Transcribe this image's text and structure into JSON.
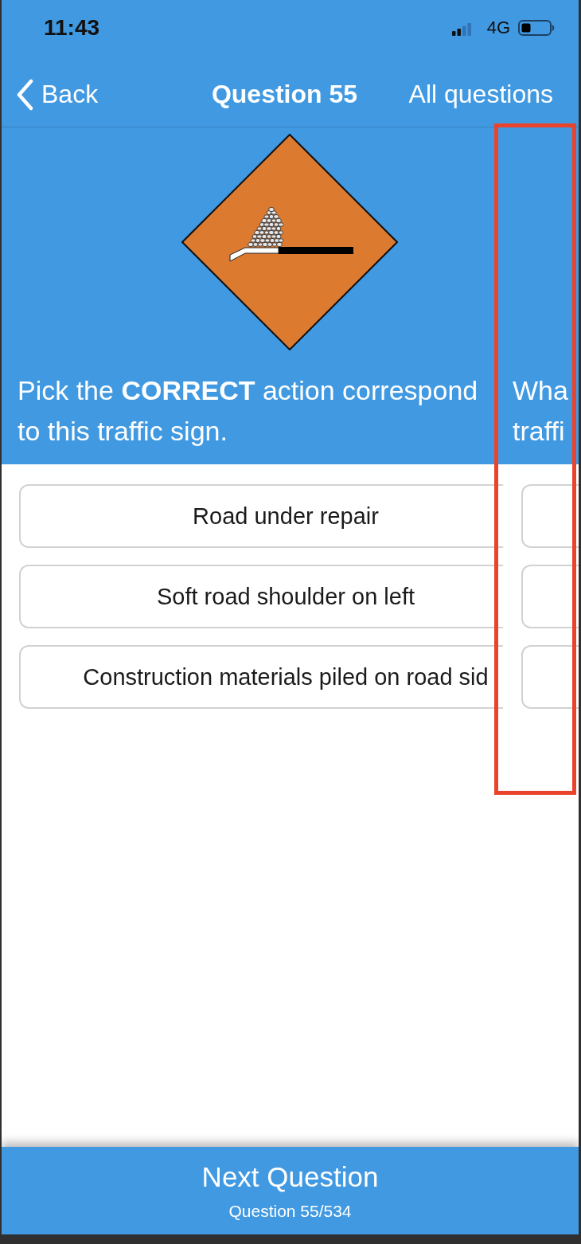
{
  "status_bar": {
    "time": "11:43",
    "network": "4G"
  },
  "nav": {
    "back": "Back",
    "title": "Question 55",
    "all_questions": "All questions"
  },
  "slides": [
    {
      "question_lines": [
        "Pick the **CORRECT** action correspond",
        "to this traffic sign."
      ],
      "answers": [
        {
          "text": "Road under repair",
          "selected": false
        },
        {
          "text": "Soft road shoulder on left",
          "selected": false
        },
        {
          "text": "Construction materials piled on road sid",
          "selected": false
        }
      ]
    },
    {
      "question_lines": [
        "Wha",
        "traffi"
      ],
      "answers": [
        {
          "selected": false
        },
        {
          "selected": false
        },
        {
          "selected": false
        }
      ]
    }
  ],
  "footer": {
    "button": "Next Question",
    "counter": "Question 55/534"
  }
}
